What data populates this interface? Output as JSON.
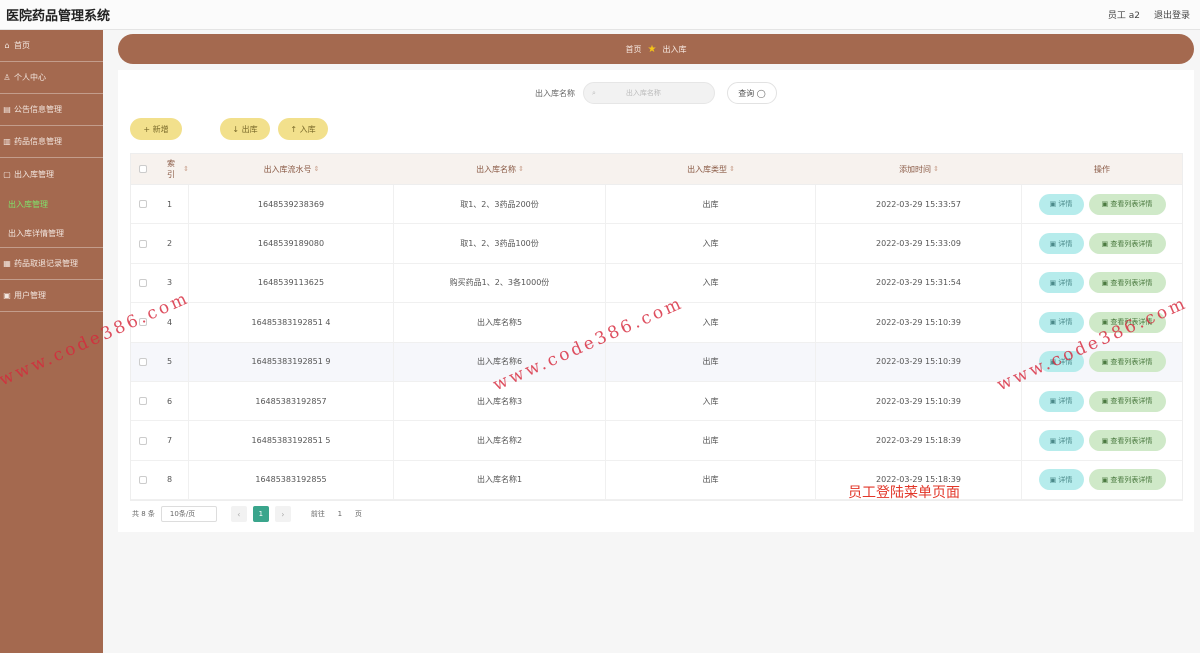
{
  "app": {
    "title": "医院药品管理系统"
  },
  "topbar": {
    "user": "员工 a2",
    "logout": "退出登录"
  },
  "sidebar": {
    "items": [
      {
        "icon": "home-icon",
        "glyph": "⌂",
        "label": "首页"
      },
      {
        "icon": "user-icon",
        "glyph": "♙",
        "label": "个人中心"
      },
      {
        "icon": "notice-icon",
        "glyph": "▤",
        "label": "公告信息管理"
      },
      {
        "icon": "drug-icon",
        "glyph": "▥",
        "label": "药品信息管理"
      },
      {
        "icon": "warehouse-icon",
        "glyph": "▢",
        "label": "出入库管理"
      }
    ],
    "sub_items": [
      {
        "label": "出入库管理",
        "active": true
      },
      {
        "label": "出入库详情管理",
        "active": false
      }
    ],
    "more_items": [
      {
        "icon": "record-icon",
        "glyph": "▦",
        "label": "药品取退记录管理"
      },
      {
        "icon": "account-icon",
        "glyph": "▣",
        "label": "用户管理"
      }
    ]
  },
  "breadcrumb": {
    "home": "首页",
    "current": "出入库"
  },
  "search": {
    "label": "出入库名称",
    "placeholder": "出入库名称",
    "button": "查询 ◯"
  },
  "actions": {
    "add": "+ 新增",
    "out": "↓ 出库",
    "in": "↑ 入库"
  },
  "table": {
    "headers": {
      "index": "索引",
      "serial": "出入库流水号",
      "name": "出入库名称",
      "type": "出入库类型",
      "time": "添加时间",
      "op": "操作"
    },
    "detail_label": "▣ 详情",
    "list_label": "▣ 查看列表详情",
    "rows": [
      {
        "index": "1",
        "serial": "1648539238369",
        "name": "取1、2、3药品200份",
        "type": "出库",
        "time": "2022-03-29 15:33:57"
      },
      {
        "index": "2",
        "serial": "1648539189080",
        "name": "取1、2、3药品100份",
        "type": "入库",
        "time": "2022-03-29 15:33:09"
      },
      {
        "index": "3",
        "serial": "1648539113625",
        "name": "购买药品1、2、3各1000份",
        "type": "入库",
        "time": "2022-03-29 15:31:54"
      },
      {
        "index": "4",
        "serial": "16485383192851 4",
        "name": "出入库名称5",
        "type": "入库",
        "time": "2022-03-29 15:10:39"
      },
      {
        "index": "5",
        "serial": "16485383192851 9",
        "name": "出入库名称6",
        "type": "出库",
        "time": "2022-03-29 15:10:39"
      },
      {
        "index": "6",
        "serial": "16485383192857",
        "name": "出入库名称3",
        "type": "入库",
        "time": "2022-03-29 15:10:39"
      },
      {
        "index": "7",
        "serial": "16485383192851 5",
        "name": "出入库名称2",
        "type": "出库",
        "time": "2022-03-29 15:18:39"
      },
      {
        "index": "8",
        "serial": "16485383192855",
        "name": "出入库名称1",
        "type": "出库",
        "time": "2022-03-29 15:18:39"
      }
    ]
  },
  "pager": {
    "total": "共 8 条",
    "size": "10条/页",
    "prev": "‹",
    "page": "1",
    "next": "›",
    "goto": "前往",
    "goto_value": "1",
    "suffix": "页"
  },
  "watermark": {
    "text": "www.code386.com"
  },
  "annotation": {
    "text": "员工登陆菜单页面"
  }
}
